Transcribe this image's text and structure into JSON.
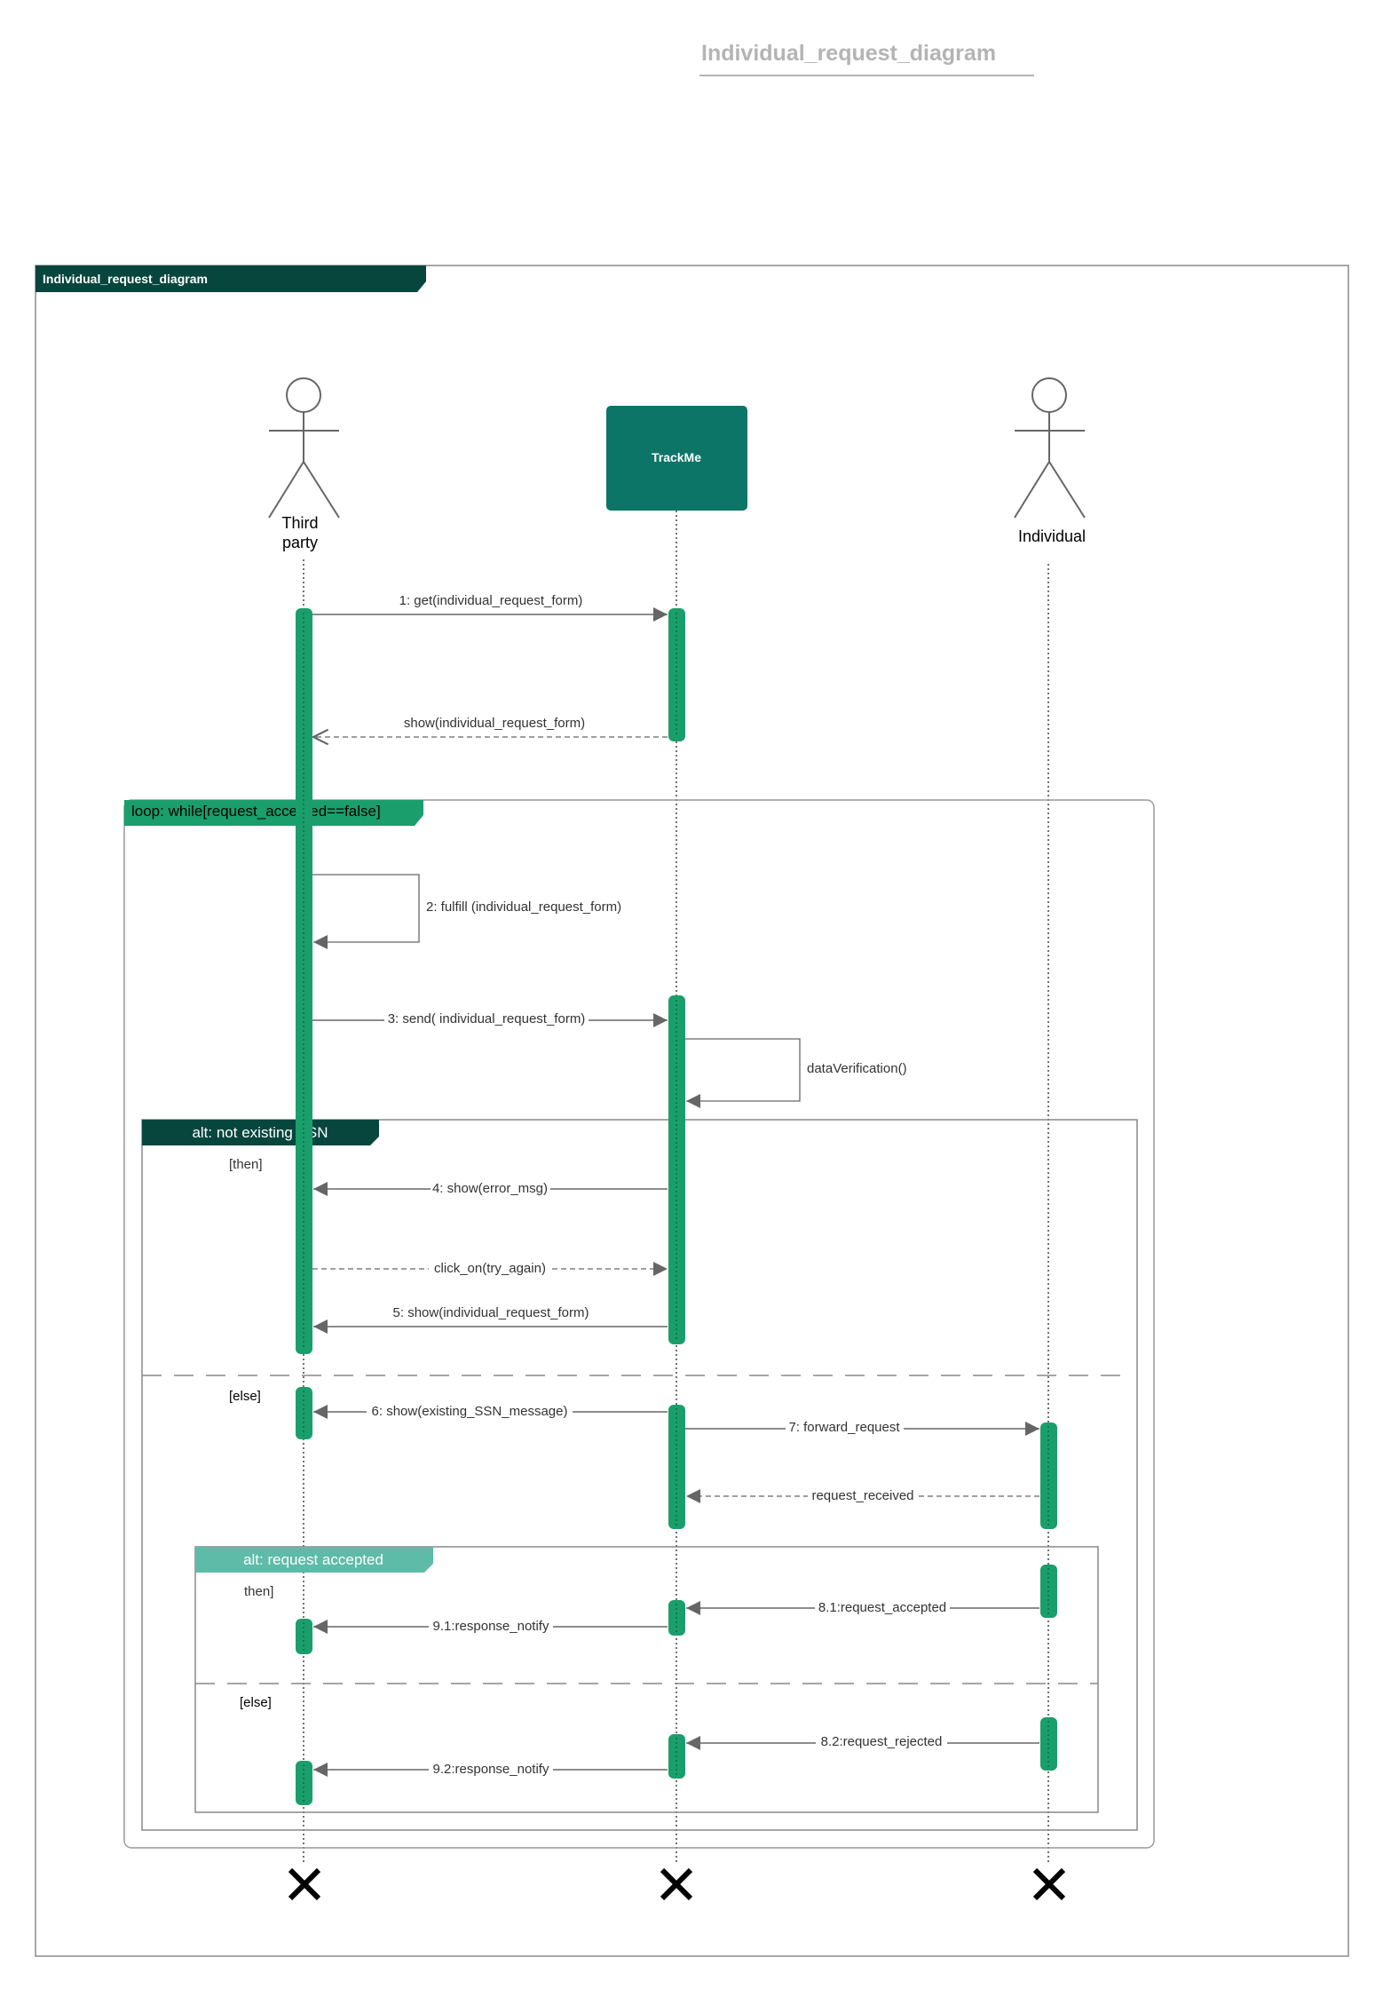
{
  "page_title": "Individual_request_diagram",
  "frame_title": "Individual_request_diagram",
  "colors": {
    "dark_green": "#07463d",
    "teal": "#0d7567",
    "activation_green": "#1a9e6c",
    "light_teal": "#5dbba7",
    "line_gray": "#666666",
    "title_gray": "#b4b4b4"
  },
  "lifelines": {
    "third_party": {
      "label_line1": "Third",
      "label_line2": "party",
      "kind": "actor"
    },
    "trackme": {
      "label": "TrackMe",
      "kind": "system-box"
    },
    "individual": {
      "label": "Individual",
      "kind": "actor"
    }
  },
  "fragments": {
    "loop": {
      "label": "loop: while[request_accepted==false]"
    },
    "alt_ssn": {
      "label": "alt: not existing SSN",
      "guard_then": "[then]",
      "guard_else": "[else]"
    },
    "alt_accepted": {
      "label": "alt: request accepted",
      "guard_then": "then]",
      "guard_else": "[else]"
    }
  },
  "messages": {
    "m1": "1: get(individual_request_form)",
    "m1r": "show(individual_request_form)",
    "m2": "2: fulfill (individual_request_form)",
    "m3": "3: send( individual_request_form)",
    "mdv": "dataVerification()",
    "m4": "4: show(error_msg)",
    "mclick": "click_on(try_again)",
    "m5": "5: show(individual_request_form)",
    "m6": "6: show(existing_SSN_message)",
    "m7": "7: forward_request",
    "m7r": "request_received",
    "m81": "8.1:request_accepted",
    "m91": "9.1:response_notify",
    "m82": "8.2:request_rejected",
    "m92": "9.2:response_notify"
  }
}
